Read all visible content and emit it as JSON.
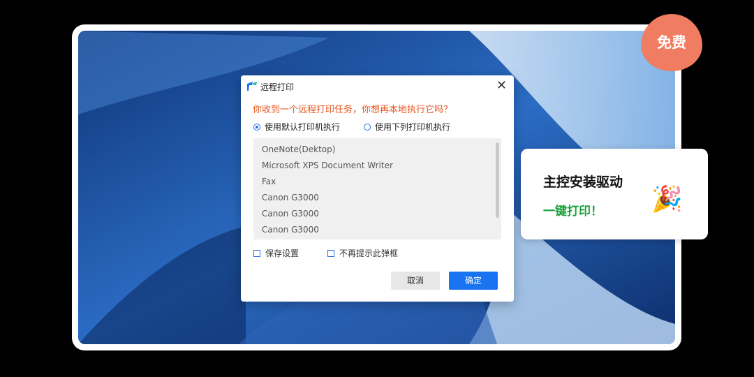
{
  "badge": {
    "text": "免费"
  },
  "dialog": {
    "title": "远程打印",
    "question": "你收到一个远程打印任务，你想再本地执行它吗？",
    "radio_default": "使用默认打印机执行",
    "radio_list": "使用下列打印机执行",
    "selected_radio": "default",
    "printers": [
      "OneNote(Dektop)",
      "Microsoft XPS Document Writer",
      "Fax",
      "Canon G3000",
      "Canon G3000",
      "Canon G3000"
    ],
    "save_settings": "保存设置",
    "no_prompt": "不再提示此弹框",
    "cancel": "取消",
    "ok": "确定"
  },
  "promo": {
    "line1": "主控安装驱动",
    "line2": "一键打印！",
    "emoji": "🎉"
  },
  "colors": {
    "accent": "#1a73f0",
    "question": "#e8561f",
    "promo_green": "#1aa33a",
    "badge": "#f07d62"
  }
}
